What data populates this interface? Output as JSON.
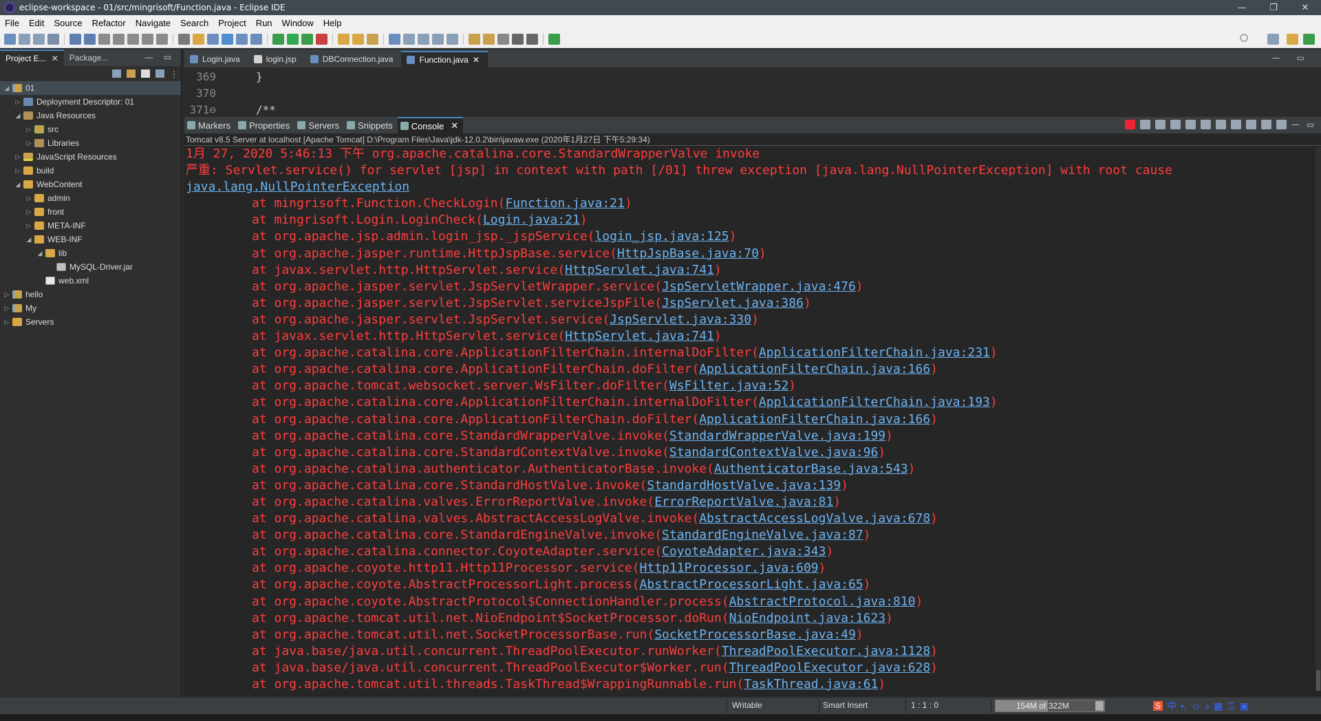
{
  "window": {
    "title": "eclipse-workspace - 01/src/mingrisoft/Function.java - Eclipse IDE",
    "controls": [
      "—",
      "❐",
      "✕"
    ]
  },
  "menu": [
    "File",
    "Edit",
    "Source",
    "Refactor",
    "Navigate",
    "Search",
    "Project",
    "Run",
    "Window",
    "Help"
  ],
  "explorer": {
    "tabs": [
      {
        "label": "Project E...",
        "active": true
      },
      {
        "label": "Package...",
        "active": false
      }
    ],
    "tree": [
      {
        "label": "01",
        "depth": 0,
        "arrow": "◢",
        "icon": "project",
        "selected": true
      },
      {
        "label": "Deployment Descriptor: 01",
        "depth": 1,
        "arrow": "▷",
        "icon": "dd"
      },
      {
        "label": "Java Resources",
        "depth": 1,
        "arrow": "◢",
        "icon": "lib"
      },
      {
        "label": "src",
        "depth": 2,
        "arrow": "▷",
        "icon": "pkg"
      },
      {
        "label": "Libraries",
        "depth": 2,
        "arrow": "▷",
        "icon": "lib"
      },
      {
        "label": "JavaScript Resources",
        "depth": 1,
        "arrow": "▷",
        "icon": "js"
      },
      {
        "label": "build",
        "depth": 1,
        "arrow": "▷",
        "icon": "folder"
      },
      {
        "label": "WebContent",
        "depth": 1,
        "arrow": "◢",
        "icon": "folder"
      },
      {
        "label": "admin",
        "depth": 2,
        "arrow": "▷",
        "icon": "folder"
      },
      {
        "label": "front",
        "depth": 2,
        "arrow": "▷",
        "icon": "folder"
      },
      {
        "label": "META-INF",
        "depth": 2,
        "arrow": "▷",
        "icon": "folder"
      },
      {
        "label": "WEB-INF",
        "depth": 2,
        "arrow": "◢",
        "icon": "folder"
      },
      {
        "label": "lib",
        "depth": 3,
        "arrow": "◢",
        "icon": "folder"
      },
      {
        "label": "MySQL-Driver.jar",
        "depth": 4,
        "arrow": "",
        "icon": "jar"
      },
      {
        "label": "web.xml",
        "depth": 3,
        "arrow": "",
        "icon": "xml"
      },
      {
        "label": "hello",
        "depth": 0,
        "arrow": "▷",
        "icon": "project"
      },
      {
        "label": "My",
        "depth": 0,
        "arrow": "▷",
        "icon": "project"
      },
      {
        "label": "Servers",
        "depth": 0,
        "arrow": "▷",
        "icon": "folder"
      }
    ]
  },
  "editor": {
    "tabs": [
      {
        "label": "Login.java",
        "active": false,
        "kind": "java"
      },
      {
        "label": "login.jsp",
        "active": false,
        "kind": "jsp"
      },
      {
        "label": "DBConnection.java",
        "active": false,
        "kind": "java"
      },
      {
        "label": "Function.java",
        "active": true,
        "kind": "java"
      }
    ],
    "lines": [
      {
        "num": "369",
        "code": "}"
      },
      {
        "num": "370",
        "code": ""
      },
      {
        "num": "371⊖",
        "code": "/**"
      }
    ]
  },
  "console": {
    "tabs": [
      {
        "label": "Markers",
        "active": false
      },
      {
        "label": "Properties",
        "active": false
      },
      {
        "label": "Servers",
        "active": false
      },
      {
        "label": "Snippets",
        "active": false
      },
      {
        "label": "Console",
        "active": true
      }
    ],
    "description": "Tomcat v8.5 Server at localhost [Apache Tomcat] D:\\Program Files\\Java\\jdk-12.0.2\\bin\\javaw.exe (2020年1月27日 下午5:29:34)",
    "header_lines": [
      "1月 27, 2020 5:46:13 下午 org.apache.catalina.core.StandardWrapperValve invoke",
      "严重: Servlet.service() for servlet [jsp] in context with path [/01] threw exception [java.lang.NullPointerException] with root cause"
    ],
    "exception_link": "java.lang.NullPointerException",
    "stack": [
      {
        "method": "at mingrisoft.Function.CheckLogin(",
        "link": "Function.java:21"
      },
      {
        "method": "at mingrisoft.Login.LoginCheck(",
        "link": "Login.java:21"
      },
      {
        "method": "at org.apache.jsp.admin.login_jsp._jspService(",
        "link": "login_jsp.java:125"
      },
      {
        "method": "at org.apache.jasper.runtime.HttpJspBase.service(",
        "link": "HttpJspBase.java:70"
      },
      {
        "method": "at javax.servlet.http.HttpServlet.service(",
        "link": "HttpServlet.java:741"
      },
      {
        "method": "at org.apache.jasper.servlet.JspServletWrapper.service(",
        "link": "JspServletWrapper.java:476"
      },
      {
        "method": "at org.apache.jasper.servlet.JspServlet.serviceJspFile(",
        "link": "JspServlet.java:386"
      },
      {
        "method": "at org.apache.jasper.servlet.JspServlet.service(",
        "link": "JspServlet.java:330"
      },
      {
        "method": "at javax.servlet.http.HttpServlet.service(",
        "link": "HttpServlet.java:741"
      },
      {
        "method": "at org.apache.catalina.core.ApplicationFilterChain.internalDoFilter(",
        "link": "ApplicationFilterChain.java:231"
      },
      {
        "method": "at org.apache.catalina.core.ApplicationFilterChain.doFilter(",
        "link": "ApplicationFilterChain.java:166"
      },
      {
        "method": "at org.apache.tomcat.websocket.server.WsFilter.doFilter(",
        "link": "WsFilter.java:52"
      },
      {
        "method": "at org.apache.catalina.core.ApplicationFilterChain.internalDoFilter(",
        "link": "ApplicationFilterChain.java:193"
      },
      {
        "method": "at org.apache.catalina.core.ApplicationFilterChain.doFilter(",
        "link": "ApplicationFilterChain.java:166"
      },
      {
        "method": "at org.apache.catalina.core.StandardWrapperValve.invoke(",
        "link": "StandardWrapperValve.java:199"
      },
      {
        "method": "at org.apache.catalina.core.StandardContextValve.invoke(",
        "link": "StandardContextValve.java:96"
      },
      {
        "method": "at org.apache.catalina.authenticator.AuthenticatorBase.invoke(",
        "link": "AuthenticatorBase.java:543"
      },
      {
        "method": "at org.apache.catalina.core.StandardHostValve.invoke(",
        "link": "StandardHostValve.java:139"
      },
      {
        "method": "at org.apache.catalina.valves.ErrorReportValve.invoke(",
        "link": "ErrorReportValve.java:81"
      },
      {
        "method": "at org.apache.catalina.valves.AbstractAccessLogValve.invoke(",
        "link": "AbstractAccessLogValve.java:678"
      },
      {
        "method": "at org.apache.catalina.core.StandardEngineValve.invoke(",
        "link": "StandardEngineValve.java:87"
      },
      {
        "method": "at org.apache.catalina.connector.CoyoteAdapter.service(",
        "link": "CoyoteAdapter.java:343"
      },
      {
        "method": "at org.apache.coyote.http11.Http11Processor.service(",
        "link": "Http11Processor.java:609"
      },
      {
        "method": "at org.apache.coyote.AbstractProcessorLight.process(",
        "link": "AbstractProcessorLight.java:65"
      },
      {
        "method": "at org.apache.coyote.AbstractProtocol$ConnectionHandler.process(",
        "link": "AbstractProtocol.java:810"
      },
      {
        "method": "at org.apache.tomcat.util.net.NioEndpoint$SocketProcessor.doRun(",
        "link": "NioEndpoint.java:1623"
      },
      {
        "method": "at org.apache.tomcat.util.net.SocketProcessorBase.run(",
        "link": "SocketProcessorBase.java:49"
      },
      {
        "method": "at java.base/java.util.concurrent.ThreadPoolExecutor.runWorker(",
        "link": "ThreadPoolExecutor.java:1128"
      },
      {
        "method": "at java.base/java.util.concurrent.ThreadPoolExecutor$Worker.run(",
        "link": "ThreadPoolExecutor.java:628"
      },
      {
        "method": "at org.apache.tomcat.util.threads.TaskThread$WrappingRunnable.run(",
        "link": "TaskThread.java:61"
      }
    ],
    "close_paren": ")"
  },
  "status": {
    "writable": "Writable",
    "insert_mode": "Smart Insert",
    "position": "1 : 1 : 0",
    "heap_used": "154M",
    "heap_total": "of 322M",
    "heap_fraction": 0.48,
    "ime_label": "中"
  },
  "colors": {
    "console_error": "#ff3d3d",
    "console_link": "#6db3f2",
    "active_tab_accent": "#4a88c7"
  }
}
